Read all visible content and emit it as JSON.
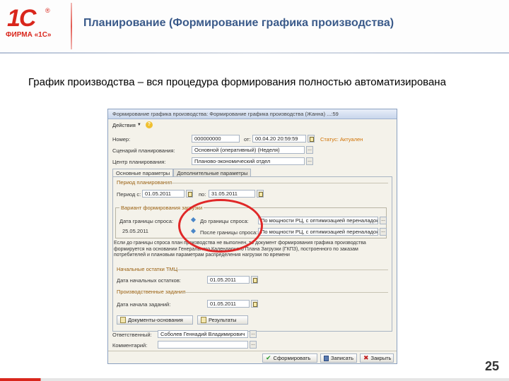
{
  "slide": {
    "logo_text": "1С",
    "logo_reg": "®",
    "logo_sub": "ФИРМА «1С»",
    "title": "Планирование (Формирование графика производства)",
    "lead": "График производства – вся процедура формирования полностью автоматизирована",
    "page_number": "25"
  },
  "window": {
    "title": "Формирование графика производства: Формирование графика производства (Жанна) ...:59",
    "toolbar": {
      "actions_label": "Действия",
      "help_label": "?"
    },
    "fields": {
      "number_label": "Номер:",
      "number_value": "000000000",
      "from_label": "от:",
      "from_value": "00.04.20   20:59:59",
      "status_text": "Статус: Актуален",
      "scenario_label": "Сценарий планирования:",
      "scenario_value": "Основной (оперативный) (Неделя)",
      "planning_center_label": "Центр планирования:",
      "planning_center_value": "Планово-экономический отдел"
    },
    "tabs": [
      {
        "label": "Основные параметры"
      },
      {
        "label": "Дополнительные параметры"
      }
    ],
    "period_section": "Период планирования",
    "period_from_label": "Период с:",
    "period_from_value": "01.05.2011",
    "period_to_label": "по:",
    "period_to_value": "31.05.2011",
    "variant_section": "Вариант формирования загрузки",
    "boundary_label": "Дата границы спроса:",
    "boundary_value": "25.05.2011",
    "before_boundary_label": "До границы спроса:",
    "before_boundary_value": "По мощности РЦ, с оптимизацией переналадок",
    "after_boundary_label": "После границы спроса:",
    "after_boundary_value": "По мощности РЦ, с оптимизацией переналадок",
    "info_text": "Если до границы спроса план производства не выполнен, то документ формирования графика производства формируется на основании Генерального Календарного Плана Загрузки (ГКПЗ), построенного по заказам потребителей и плановым параметрам распределения нагрузки по времени",
    "wip_section": "Начальные остатки ТМЦ",
    "wip_date_label": "Дата начальных остатков:",
    "wip_date_value": "01.05.2011",
    "tasks_section": "Производственные задания",
    "tasks_date_label": "Дата начала заданий:",
    "tasks_date_value": "01.05.2011",
    "doc_button": "Документы-основания",
    "results_button": "Результаты",
    "responsible_label": "Ответственный:",
    "responsible_value": "Соболев Геннадий Владимирович",
    "comment_label": "Комментарий:",
    "comment_value": "",
    "form_button": "Сформировать",
    "save_button": "Записать",
    "close_button": "Закрыть"
  },
  "colors": {
    "brand_red": "#d9261c",
    "title_blue": "#3a5a8a",
    "status_orange": "#d07000",
    "highlight_circle": "#e02828"
  }
}
